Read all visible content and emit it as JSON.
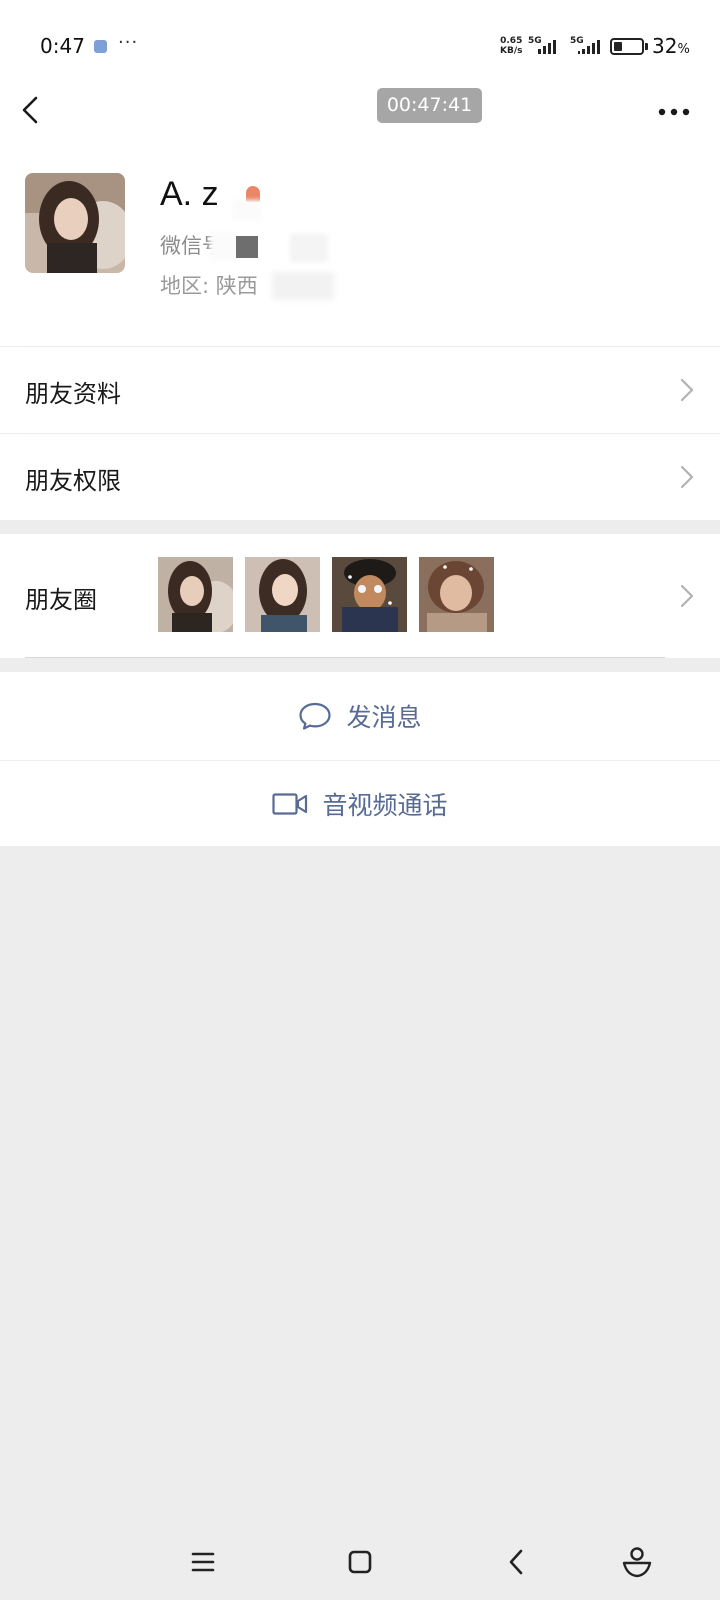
{
  "status_bar": {
    "time": "0:47",
    "more_indicator": "···",
    "net_speed_value": "0.65",
    "net_speed_unit": "KB/s",
    "network_1": "5G",
    "network_2": "5G",
    "battery_level": 0.32,
    "battery_percent": "32",
    "battery_percent_sign": "%"
  },
  "header": {
    "back_icon": "chevron-left-icon",
    "timer": "00:47:41",
    "more_icon": "more-dots-icon"
  },
  "profile": {
    "name": "A.  z",
    "wechat_id_label": "微信号",
    "region_label": "地区:  陕西"
  },
  "menu": {
    "friend_info": "朋友资料",
    "friend_permissions": "朋友权限",
    "moments": "朋友圈"
  },
  "actions": {
    "send_message": "发消息",
    "av_call": "音视频通话"
  },
  "nav": {
    "menu_icon": "menu-lines-icon",
    "home_icon": "home-square-icon",
    "back_icon": "back-arrow-icon",
    "assistant_icon": "assistant-icon"
  },
  "colors": {
    "link": "#576b95",
    "background": "#ededed",
    "timer_pill": "#a6a6a6"
  }
}
